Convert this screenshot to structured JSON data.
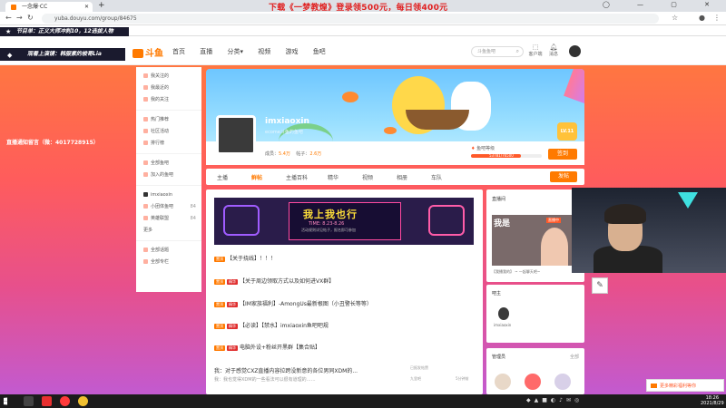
{
  "browser": {
    "tab_title": "一念爆·CC",
    "new_tab": "+",
    "promo": "下载《一梦教煌》登录领500元，每日领400元",
    "url": "yuba.douyu.com/group/84675",
    "window_controls": "◯ — ▢ ✕"
  },
  "overlays": {
    "top_text": "节目单：正义大师冲刺10，12选拔人物",
    "second_text": "观看上演镜：韩服素的梭哥Lia",
    "danmu": "直播通知留言（微：4017728915）"
  },
  "site": {
    "logo": "斗鱼",
    "nav": [
      "首页",
      "直播",
      "分类▾",
      "视频",
      "游戏",
      "鱼吧"
    ],
    "search_placeholder": "斗鱼鱼吧",
    "header_icons": [
      {
        "label": "客户端"
      },
      {
        "label": "消息"
      }
    ]
  },
  "sidebar": {
    "items": [
      {
        "label": "我关注的"
      },
      {
        "label": "我最近的"
      },
      {
        "label": "我的关注"
      }
    ],
    "items2": [
      {
        "label": "热门推荐"
      },
      {
        "label": "社区活动"
      },
      {
        "label": "排行榜"
      }
    ],
    "items3": [
      {
        "label": "全部鱼吧"
      },
      {
        "label": "加入的鱼吧"
      }
    ],
    "items4": [
      {
        "label": "imxiaoxin",
        "count": ""
      },
      {
        "label": "小团体鱼吧",
        "count": "84"
      },
      {
        "label": "英雄联盟",
        "count": "84"
      },
      {
        "label": "更多",
        "count": ""
      }
    ],
    "items5": [
      {
        "label": "全部话题"
      },
      {
        "label": "全部专栏"
      }
    ]
  },
  "profile": {
    "name": "imxiaoxin",
    "id": "ecome斗鱼的鱼吧",
    "stats_label_1": "成员：",
    "stats_value_1": "5.4万",
    "stats_label_2": "帖子：",
    "stats_value_2": "2.6万",
    "level_label": "鱼吧等级",
    "level_value": "53781/76500",
    "level_progress": 0.7,
    "badge": "LV.11",
    "sign_button": "签到",
    "post_button": "发帖"
  },
  "tabs": [
    "主播",
    "鲜帖",
    "主播百科",
    "精华",
    "视频",
    "相册",
    "车队"
  ],
  "feed": {
    "banner_title": "我上我也行",
    "banner_time": "TIME: 8.23-8.26",
    "banner_sub": "活动规则详见帖子，报名即可参加",
    "posts": [
      {
        "tags": [
          "置顶"
        ],
        "text": "【关于挠线】！！！"
      },
      {
        "tags": [
          "置顶",
          "精华"
        ],
        "text": "【关于周边领取方式以及如何进VX群】"
      },
      {
        "tags": [
          "置顶",
          "精华"
        ],
        "text": "【IM家族福利】-AmongUs最新根图（小丑警长等等）"
      },
      {
        "tags": [
          "置顶",
          "精华"
        ],
        "text": "【必读】【禁水】imxiaoxin鱼吧吧规"
      },
      {
        "tags": [
          "置顶",
          "精华"
        ],
        "text": "电脑外设+粉丝开黑群【集合贴】"
      }
    ],
    "last_post_title": "我：对于感觉CXZ直播内容拉跨没新意的各位男同XDM的...",
    "last_post_sub": "我：我也觉得XDM的一些看法可以很有道理的……",
    "last_post_meta_1": "已报发帖赞",
    "last_post_meta_2": "九里吧",
    "last_post_meta_3": "5分钟前"
  },
  "right": {
    "live_title": "直播间",
    "live_thumb_text": "我是",
    "live_badge": "直播中",
    "live_caption": "【我播我的】 ~ 一起聊天吧~",
    "owner_title": "吧主",
    "owner_name": "imxiaoxin",
    "mods_title": "管理员",
    "mods_more": "全部"
  },
  "float_ad": "更多精彩福利等你",
  "taskbar": {
    "time": "18:26",
    "date": "2021/8/29"
  },
  "colors": {
    "accent": "#ff7a00",
    "danger": "#e03030"
  }
}
